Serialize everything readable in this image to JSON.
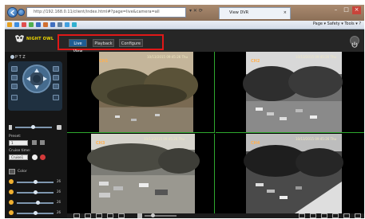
{
  "browser": {
    "address": "http://192.168.0.11/client/index.html#?page=live&camera=all",
    "tab_title": "View DVR",
    "tab_close": "×",
    "menu": "Page ▾  Safety ▾  Tools ▾  ?",
    "window_controls": [
      "–",
      "□",
      "×"
    ],
    "address_icons": "▾ ✕ ⟳"
  },
  "app": {
    "logo_text": "NIGHT OWL",
    "tabs": [
      {
        "label": "Live View",
        "active": true
      },
      {
        "label": "Playback",
        "active": false
      },
      {
        "label": "Configure",
        "active": false
      }
    ]
  },
  "sidebar": {
    "ptz_label": "P T Z",
    "preset_label": "Preset:",
    "preset_value": "1",
    "cruise_label": "Cruise time:",
    "cruise_value": "Cruise1",
    "color_label": "Color",
    "color_rows": [
      {
        "value": "26",
        "level": 0.5,
        "color": "#f0b030"
      },
      {
        "value": "26",
        "level": 0.5,
        "color": "#f0b030"
      },
      {
        "value": "26",
        "level": 0.55,
        "color": "#f0b030"
      },
      {
        "value": "26",
        "level": 0.5,
        "color": "#f0b030"
      }
    ]
  },
  "cameras": [
    {
      "label": "CH1",
      "timestamp": "10/13/2015 09:45:26 Thu"
    },
    {
      "label": "CH2",
      "timestamp": "10/13/2015 09:45:26 Thu"
    },
    {
      "label": "CH3",
      "timestamp": "10/13/2015 09:45:26 Thu"
    },
    {
      "label": "CH4",
      "timestamp": "10/13/2015 09:45:26 Thu"
    }
  ],
  "colors": {
    "accent_red": "#e01818",
    "active_tab": "#1e5d93",
    "logo": "#f0d800",
    "grid_line": "#2ea82e"
  }
}
